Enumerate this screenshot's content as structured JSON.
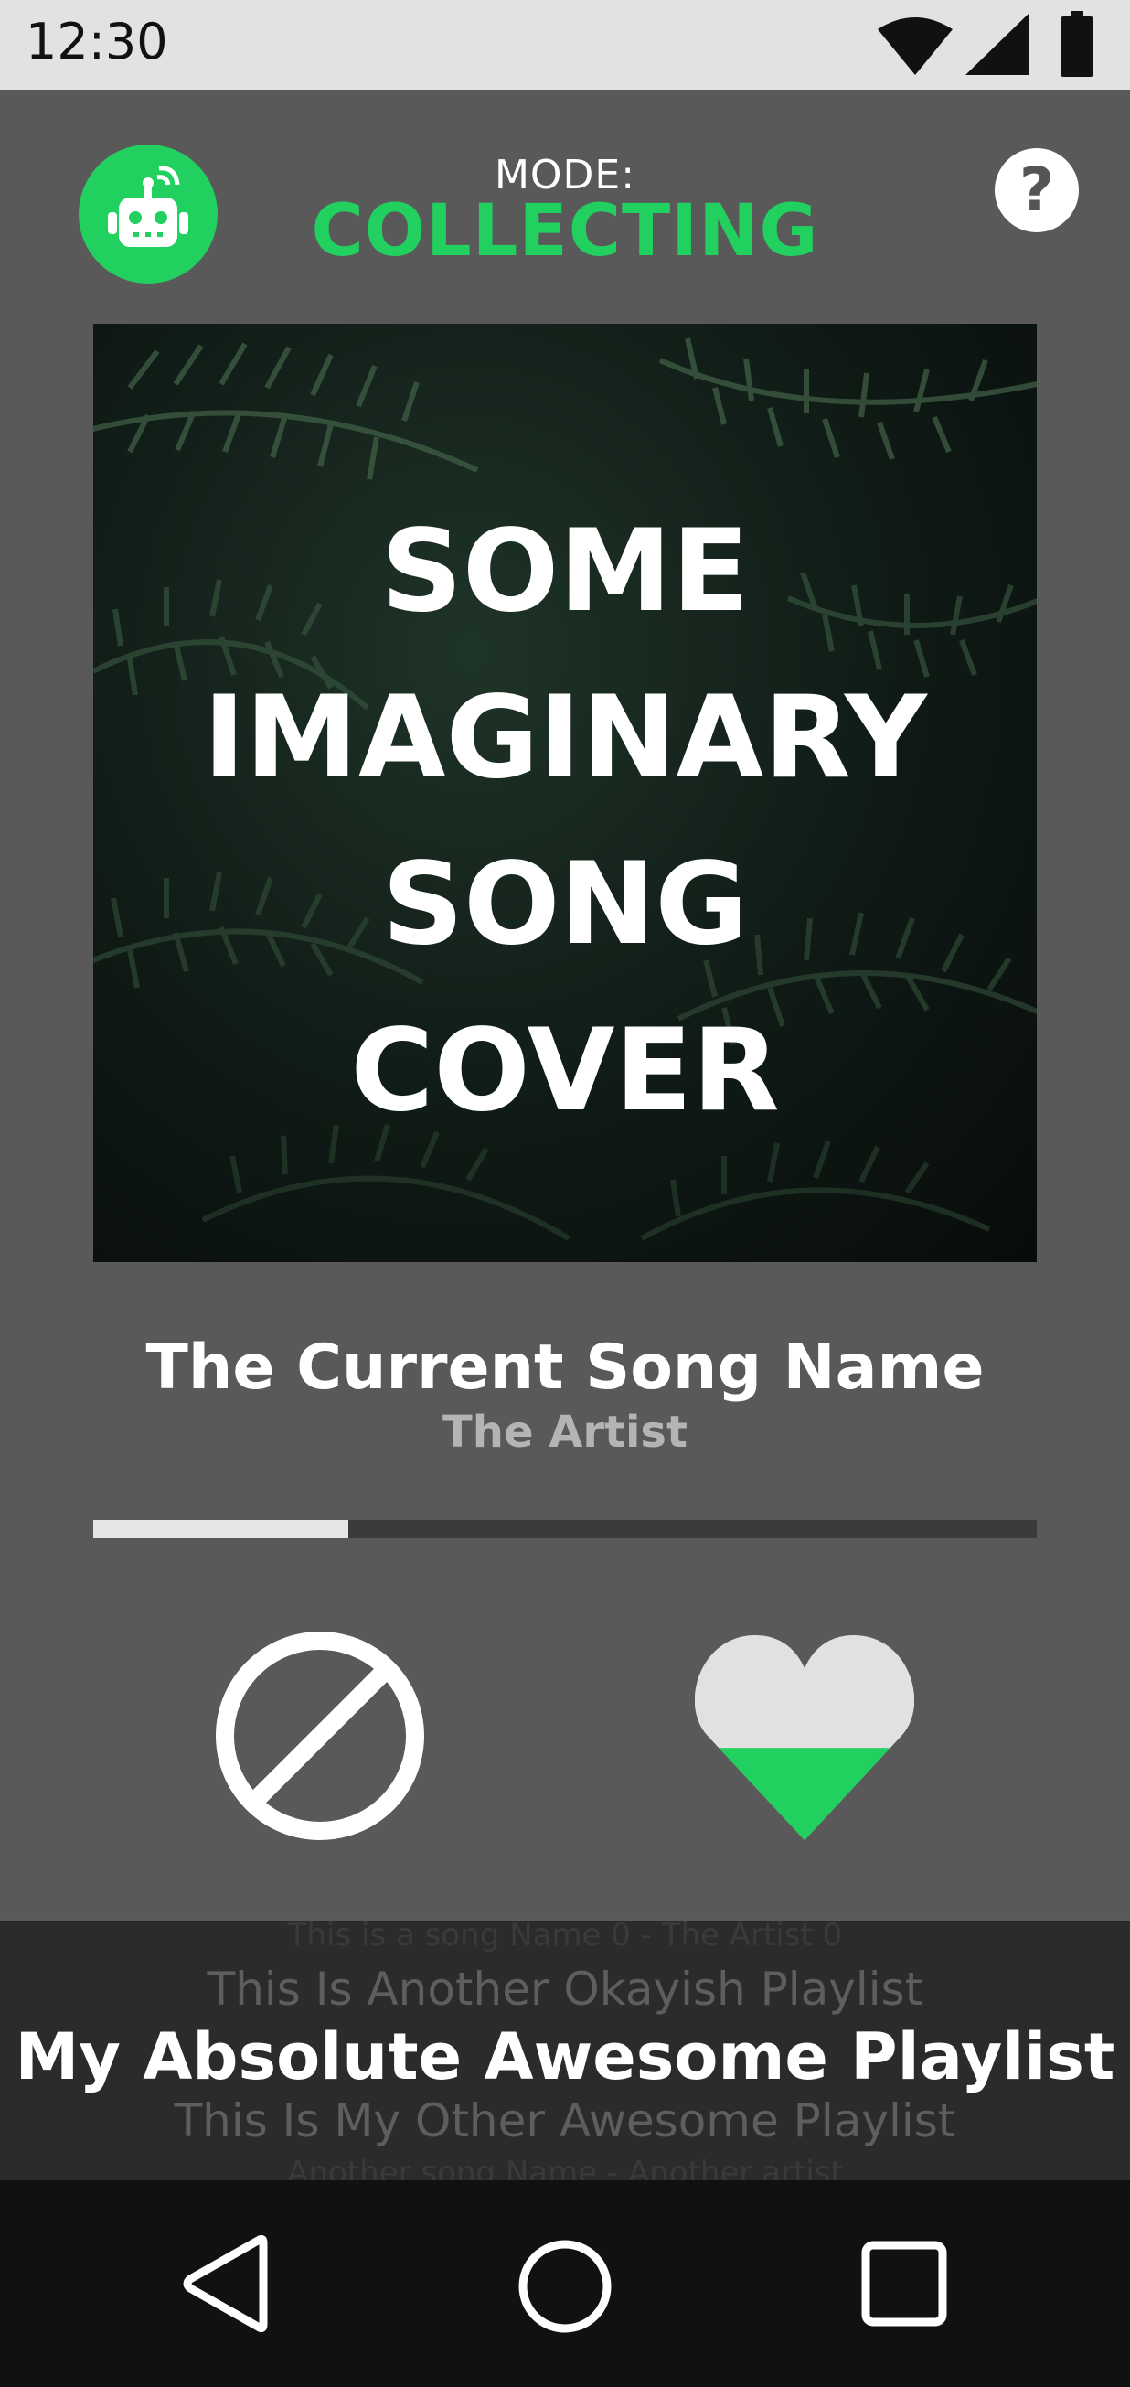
{
  "status_bar": {
    "time": "12:30",
    "icons": [
      "wifi-icon",
      "cellular-signal-icon",
      "battery-icon"
    ]
  },
  "header": {
    "robot_icon": "robot-broadcast-icon",
    "mode_label": "MODE:",
    "mode_value": "COLLECTING",
    "help_icon": "help-icon",
    "help_glyph": "?"
  },
  "player": {
    "cover_lines": [
      "SOME",
      "IMAGINARY",
      "SONG",
      "COVER"
    ],
    "song_name": "The Current Song Name",
    "artist": "The Artist",
    "progress": 0.27,
    "skip_icon": "block-icon",
    "like_icon": "heart-icon",
    "like_level": 0.45
  },
  "playlists": {
    "far_top": "This is a song Name 0 - The Artist 0",
    "near_top": "This Is Another Okayish Playlist",
    "current": "My Absolute Awesome Playlist",
    "near_bottom": "This Is My Other Awesome Playlist",
    "far_bottom": "Another song Name - Another artist"
  },
  "nav_bar": {
    "icons": [
      "back-icon",
      "home-icon",
      "recents-icon"
    ]
  },
  "colors": {
    "accent": "#21d05f",
    "background": "#595959",
    "panel": "#2b2b2b",
    "nav": "#111111",
    "status_bar": "#e2e2e2"
  }
}
